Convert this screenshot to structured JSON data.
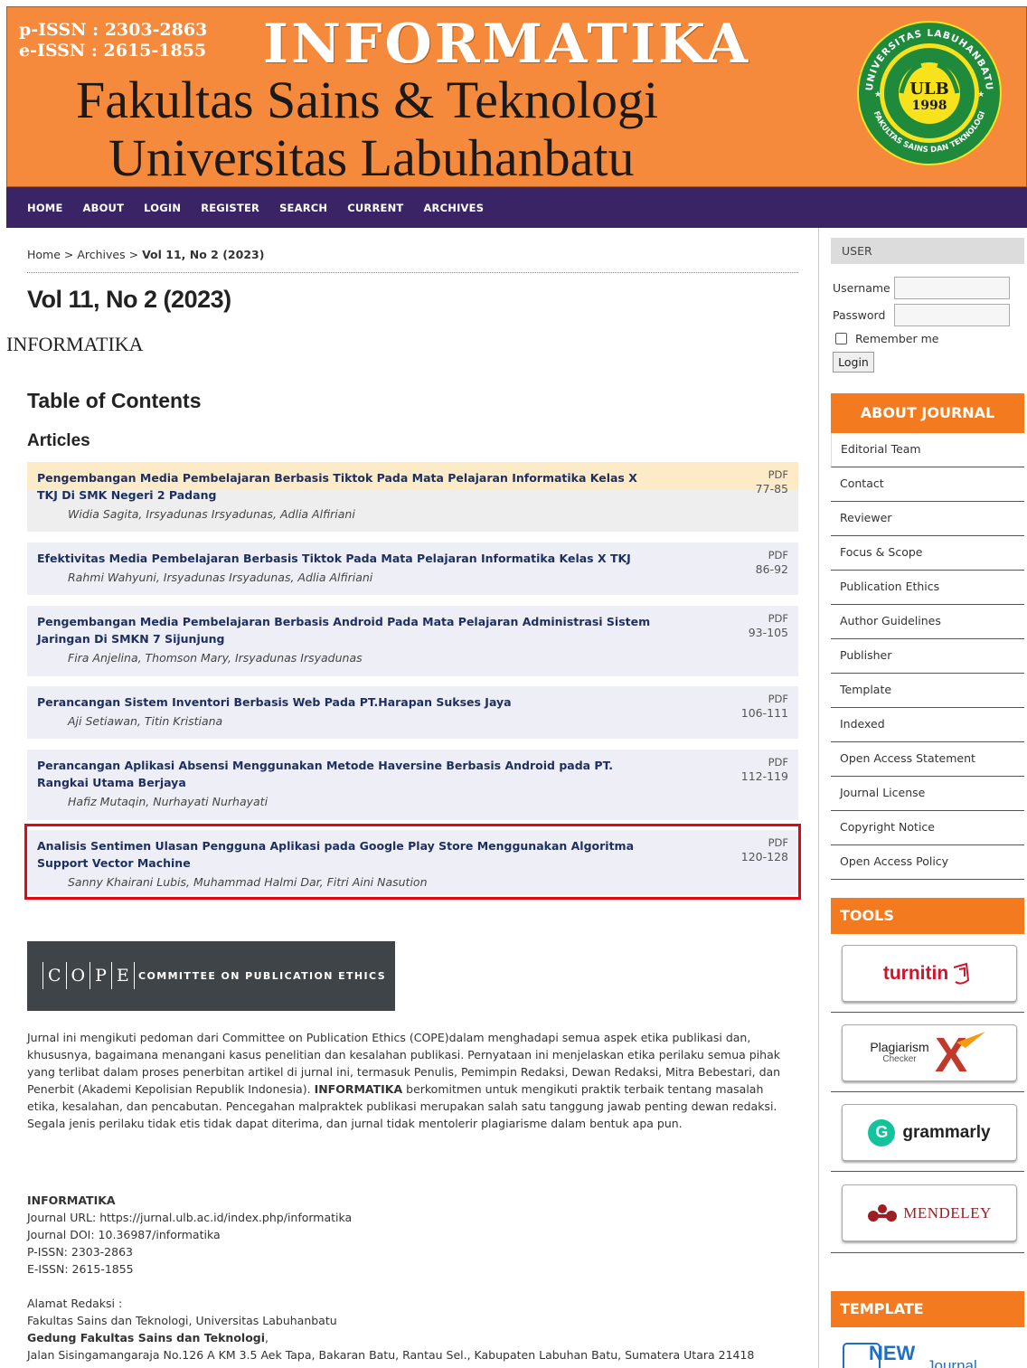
{
  "header": {
    "issn_print": "p-ISSN : 2303-2863",
    "issn_online": "e-ISSN : 2615-1855",
    "brand": "INFORMATIKA",
    "faculty": "Fakultas Sains & Teknologi",
    "university": "Universitas Labuhanbatu",
    "seal": {
      "ring_text_top": "UNIVERSITAS LABUHANBATU",
      "ring_text_bottom": "FAKULTAS SAINS DAN TEKNOLOGI",
      "center_line1": "ULB",
      "center_line2": "1998"
    }
  },
  "nav": {
    "items": [
      "HOME",
      "ABOUT",
      "LOGIN",
      "REGISTER",
      "SEARCH",
      "CURRENT",
      "ARCHIVES"
    ]
  },
  "main": {
    "breadcrumb": {
      "home": "Home",
      "sep1": " > ",
      "archives": "Archives",
      "sep2": " > ",
      "current": "Vol 11, No 2 (2023)"
    },
    "volume_title": "Vol 11, No 2 (2023)",
    "journal_name": "INFORMATIKA",
    "toc_title": "Table of Contents",
    "section_title": "Articles",
    "articles": [
      {
        "title": "Pengembangan Media Pembelajaran Berbasis Tiktok Pada Mata Pelajaran Informatika Kelas X TKJ Di SMK Negeri 2 Padang",
        "authors": "Widia Sagita, Irsyadunas Irsyadunas, Adlia Alfiriani",
        "link": "PDF",
        "pages": "77-85"
      },
      {
        "title": "Efektivitas Media Pembelajaran Berbasis Tiktok Pada Mata Pelajaran Informatika Kelas X TKJ",
        "authors": "Rahmi Wahyuni, Irsyadunas Irsyadunas, Adlia Alfiriani",
        "link": "PDF",
        "pages": "86-92"
      },
      {
        "title": "Pengembangan Media Pembelajaran Berbasis Android Pada Mata Pelajaran Administrasi Sistem Jaringan Di SMKN 7 Sijunjung",
        "authors": "Fira Anjelina, Thomson Mary, Irsyadunas Irsyadunas",
        "link": "PDF",
        "pages": "93-105"
      },
      {
        "title": "Perancangan Sistem Inventori Berbasis Web Pada PT.Harapan Sukses Jaya",
        "authors": "Aji Setiawan, Titin Kristiana",
        "link": "PDF",
        "pages": "106-111"
      },
      {
        "title": "Perancangan Aplikasi Absensi Menggunakan Metode Haversine Berbasis Android pada PT. Rangkai Utama Berjaya",
        "authors": "Hafiz Mutaqin, Nurhayati Nurhayati",
        "link": "PDF",
        "pages": "112-119"
      },
      {
        "title": "Analisis Sentimen Ulasan Pengguna Aplikasi pada Google Play Store Menggunakan Algoritma Support Vector Machine",
        "authors": "Sanny Khairani Lubis, Muhammad Halmi Dar, Fitri Aini Nasution",
        "link": "PDF",
        "pages": "120-128"
      }
    ],
    "cope": {
      "letters": [
        "C",
        "O",
        "P",
        "E"
      ],
      "text": "COMMITTEE ON PUBLICATION ETHICS"
    },
    "ethics_before": "Jurnal ini mengikuti pedoman dari Committee on Publication Ethics (COPE)dalam menghadapi semua aspek etika publikasi dan, khususnya, bagaimana menangani kasus penelitian dan kesalahan publikasi. Pernyataan ini menjelaskan etika perilaku semua pihak yang terlibat dalam proses penerbitan artikel di jurnal ini, termasuk Penulis, Pemimpin Redaksi, Dewan Redaksi, Mitra Bebestari, dan Penerbit (Akademi Kepolisian Republik Indonesia).",
    "ethics_bold": "INFORMATIKA",
    "ethics_after": " berkomitmen untuk mengikuti praktik terbaik tentang masalah etika, kesalahan, dan pencabutan. Pencegahan malpraktek publikasi merupakan salah satu tanggung jawab penting dewan redaksi. Segala jenis perilaku tidak etis tidak dapat diterima, dan jurnal tidak mentolerir plagiarisme dalam bentuk apa pun.",
    "footer": {
      "name": "INFORMATIKA",
      "url": "Journal URL: https://jurnal.ulb.ac.id/index.php/informatika",
      "doi": "Journal DOI: 10.36987/informatika",
      "pissn": "P-ISSN: 2303-2863",
      "eissn": "E-ISSN: 2615-1855",
      "address_label": "Alamat Redaksi :",
      "address_line1": "Fakultas Sains dan Teknologi, Universitas Labuhanbatu",
      "building": "Gedung Fakultas Sains dan Teknologi",
      "building_suffix": ",",
      "street": "Jalan Sisingamangaraja No.126 A KM 3.5 Aek Tapa, Bakaran Batu, Rantau Sel., Kabupaten Labuhan Batu, Sumatera Utara 21418"
    }
  },
  "sidebar": {
    "user": {
      "heading": "USER",
      "username_label": "Username",
      "password_label": "Password",
      "remember_label": "Remember me",
      "login_button": "Login"
    },
    "about": {
      "heading": "ABOUT JOURNAL",
      "items": [
        "Editorial Team",
        "Contact",
        "Reviewer",
        "Focus & Scope",
        "Publication Ethics",
        "Author Guidelines",
        "Publisher",
        "Template",
        "Indexed",
        "Open Access Statement",
        "Journal License",
        "Copyright Notice",
        "Open Access Policy"
      ]
    },
    "tools": {
      "heading": "TOOLS",
      "turnitin": "turnitin",
      "plagiarism": "Plagiarism",
      "plagiarism_sub": "Checker",
      "plagiarism_mark": "X",
      "grammarly": "grammarly",
      "grammarly_mark": "G",
      "mendeley": "MENDELEY"
    },
    "template": {
      "heading": "TEMPLATE",
      "badge": "NEW",
      "badge_sub": "Journal"
    }
  },
  "colors": {
    "banner": "#f58a3c",
    "nav": "#3a2466",
    "accent": "#f47a1f",
    "article_title": "#1c2f5e",
    "highlight": "#e30613"
  }
}
